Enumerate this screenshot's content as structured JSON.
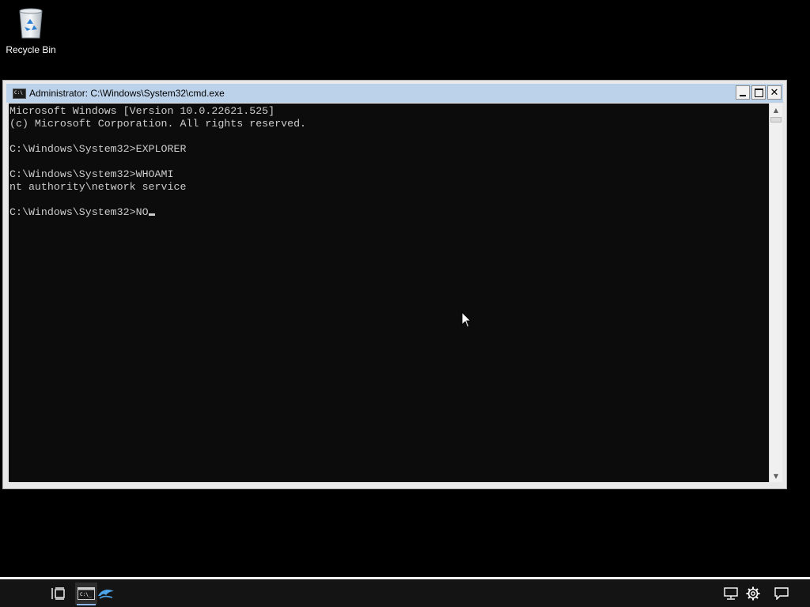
{
  "desktop": {
    "recycle_bin_label": "Recycle Bin"
  },
  "window": {
    "title": "Administrator: C:\\Windows\\System32\\cmd.exe",
    "buttons": {
      "minimize": "minimize",
      "maximize": "maximize",
      "close": "✕"
    },
    "console_lines": [
      "Microsoft Windows [Version 10.0.22621.525]",
      "(c) Microsoft Corporation. All rights reserved.",
      "",
      "C:\\Windows\\System32>EXPLORER",
      "",
      "C:\\Windows\\System32>WHOAMI",
      "nt authority\\network service",
      "",
      "C:\\Windows\\System32>NO"
    ],
    "text_color": "#cccccc",
    "background_color": "#0c0c0c",
    "title_bar_color": "#bcd2ea"
  },
  "taskbar": {
    "items": [
      {
        "name": "task-view",
        "icon": "task-view-icon"
      },
      {
        "name": "command-prompt",
        "icon": "cmd-icon",
        "active": true
      },
      {
        "name": "dolphin-app",
        "icon": "dolphin-icon"
      }
    ],
    "tray": [
      {
        "name": "network",
        "icon": "network-icon"
      },
      {
        "name": "settings",
        "icon": "gear-icon"
      },
      {
        "name": "notifications",
        "icon": "notification-icon"
      }
    ]
  }
}
